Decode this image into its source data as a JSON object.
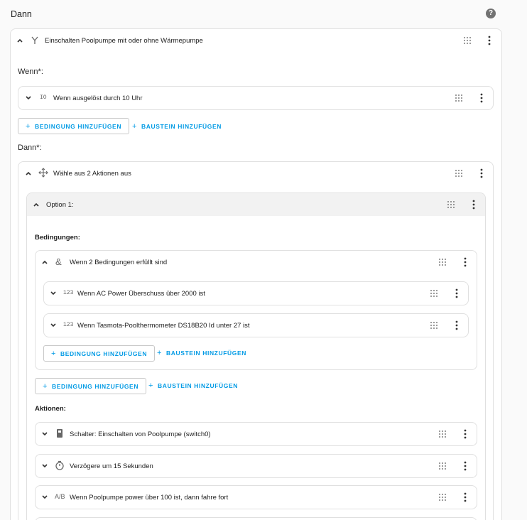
{
  "header": {
    "title": "Dann",
    "help": "?"
  },
  "main_block": {
    "title": "Einschalten Poolpumpe mit oder ohne Wärmepumpe",
    "icon": "branch-icon"
  },
  "wenn": {
    "label": "Wenn*:",
    "trigger": {
      "icon_text": "IO",
      "title": "Wenn ausgelöst durch 10 Uhr"
    }
  },
  "buttons": {
    "add_condition": "BEDINGUNG HINZUFÜGEN",
    "add_building_block": "BAUSTEIN HINZUFÜGEN",
    "plus": "+"
  },
  "dann": {
    "label": "Dann*:",
    "choose": {
      "title": "Wähle aus 2 Aktionen aus",
      "icon": "arrows-split-icon"
    },
    "option": {
      "title": "Option 1:"
    },
    "conditions_label": "Bedingungen:",
    "and_block": {
      "icon_text": "&",
      "title": "Wenn 2 Bedingungen erfüllt sind"
    },
    "conditions": [
      {
        "icon_text": "123",
        "title": "Wenn AC Power Überschuss über 2000 ist"
      },
      {
        "icon_text": "123",
        "title": "Wenn Tasmota-Poolthermometer DS18B20 Id unter 27 ist"
      }
    ],
    "actions_label": "Aktionen:",
    "actions": [
      {
        "icon": "switch-icon",
        "title": "Schalter: Einschalten von Poolpumpe (switch0)"
      },
      {
        "icon": "timer-icon",
        "title": "Verzögere um 15 Sekunden"
      },
      {
        "icon": "condition-icon",
        "icon_text": "A/B",
        "title": "Wenn Poolpumpe power über 100 ist, dann fahre fort"
      }
    ]
  }
}
